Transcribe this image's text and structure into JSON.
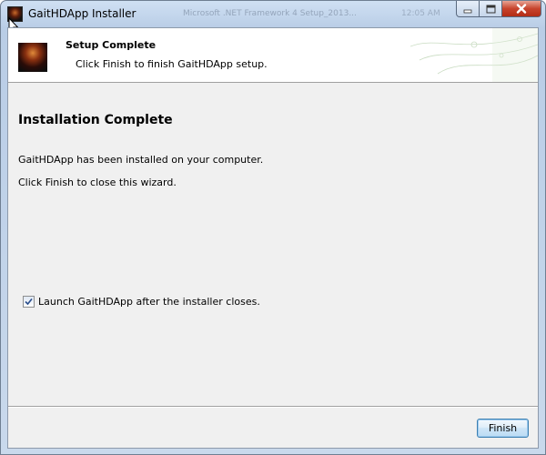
{
  "window": {
    "title": "GaitHDApp Installer",
    "background_tab_1": "Microsoft .NET Framework 4 Setup_2013...",
    "background_tab_2": "12:05 AM"
  },
  "header": {
    "title": "Setup Complete",
    "subtitle": "Click Finish to finish GaitHDApp setup."
  },
  "main": {
    "heading": "Installation Complete",
    "line1": "GaitHDApp has been installed on your computer.",
    "line2": "Click Finish to close this wizard.",
    "launch_checkbox": {
      "label": "Launch GaitHDApp after the installer closes.",
      "checked": true
    }
  },
  "footer": {
    "finish_label": "Finish"
  },
  "colors": {
    "titlebar": "#b9cde6",
    "client_bg": "#f0f0f0",
    "close_button": "#c7442d",
    "button_border": "#3c7fb1"
  },
  "icons": {
    "app": "app-icon",
    "minimize": "minimize-icon",
    "maximize": "maximize-icon",
    "close": "close-icon",
    "cursor": "mouse-pointer-icon",
    "check": "checkmark-icon"
  }
}
